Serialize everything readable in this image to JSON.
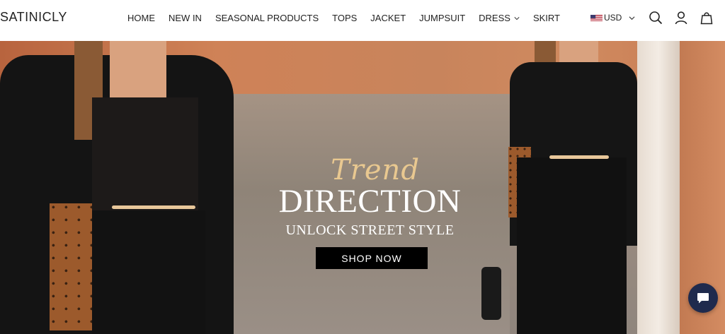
{
  "header": {
    "logo": "SATINICLY",
    "nav": [
      {
        "label": "HOME"
      },
      {
        "label": "NEW IN"
      },
      {
        "label": "SEASONAL PRODUCTS"
      },
      {
        "label": "TOPS"
      },
      {
        "label": "JACKET"
      },
      {
        "label": "JUMPSUIT"
      },
      {
        "label": "DRESS",
        "has_dropdown": true
      },
      {
        "label": "SKIRT"
      }
    ],
    "currency": "USD",
    "icons": [
      "search-icon",
      "account-icon",
      "cart-icon"
    ]
  },
  "hero": {
    "script_title": "Trend",
    "title": "DIRECTION",
    "subtitle": "UNLOCK STREET STYLE",
    "cta_label": "SHOP NOW"
  },
  "chat": {
    "icon": "chat-icon",
    "color": "#1f2a4d"
  },
  "colors": {
    "accent_gold": "#e9c890",
    "button_bg": "#000000"
  }
}
